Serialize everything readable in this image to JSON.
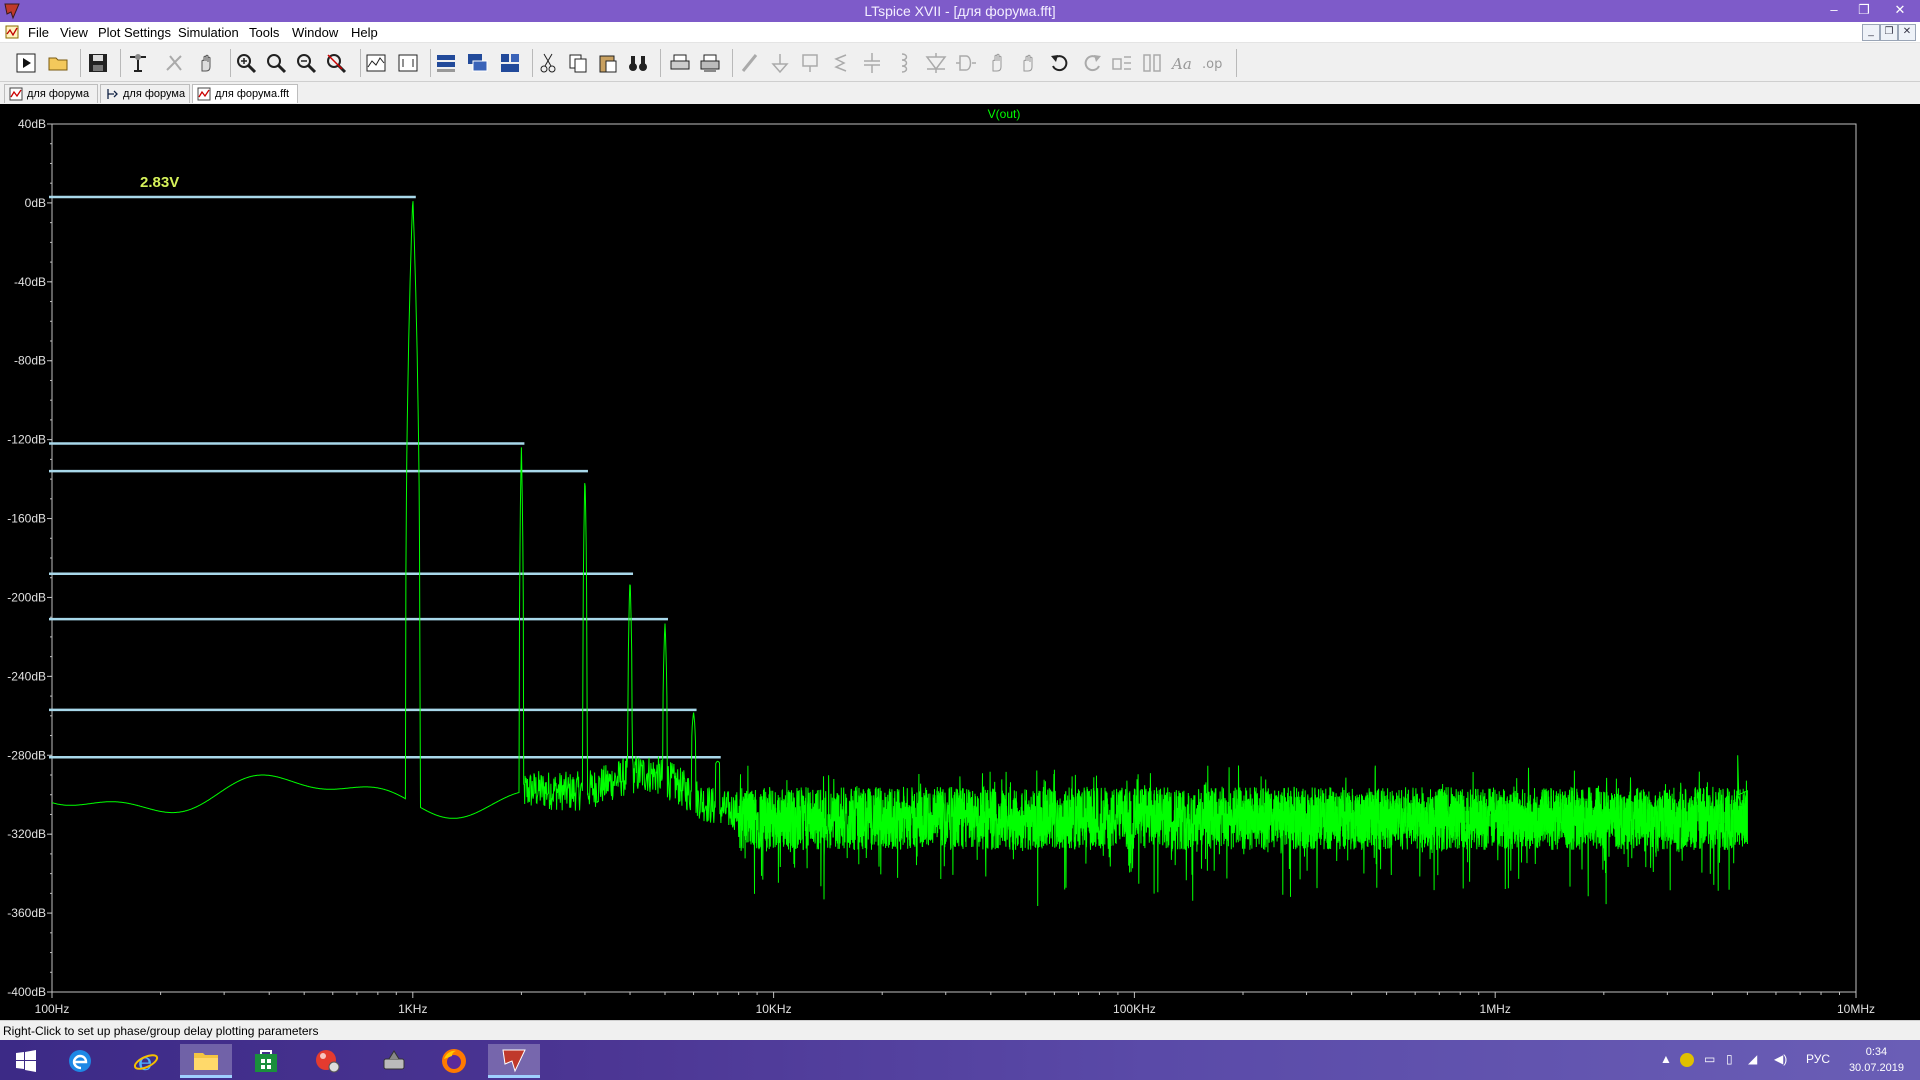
{
  "window": {
    "title": "LTspice XVII - [для форума.fft]",
    "minimize": "–",
    "restore": "❐",
    "close": "✕"
  },
  "menu": {
    "items": [
      "File",
      "View",
      "Plot Settings",
      "Simulation",
      "Tools",
      "Window",
      "Help"
    ]
  },
  "tabs": [
    {
      "label": "для форума",
      "icon": "waveform-icon"
    },
    {
      "label": "для форума",
      "icon": "schematic-icon"
    },
    {
      "label": "для форума.fft",
      "icon": "waveform-icon"
    }
  ],
  "plot": {
    "trace_label": "V(out)",
    "annotation": "2.83V",
    "background": "#000000",
    "trace_color": "#00ff00",
    "cursor_line_color": "#a8d8ea",
    "axis_color": "#c0c0c0"
  },
  "status": {
    "text": "Right-Click to set up phase/group delay plotting parameters"
  },
  "taskbar": {
    "lang": "РУС",
    "time": "0:34",
    "date": "30.07.2019"
  },
  "chart_data": {
    "type": "line",
    "title": "V(out)",
    "xlabel": "",
    "ylabel": "",
    "xscale": "log",
    "xlim": [
      100,
      10000000
    ],
    "ylim": [
      -400,
      40
    ],
    "x_ticks": [
      "100Hz",
      "1KHz",
      "10KHz",
      "100KHz",
      "1MHz",
      "10MHz"
    ],
    "y_ticks": [
      "40dB",
      "0dB",
      "-40dB",
      "-80dB",
      "-120dB",
      "-160dB",
      "-200dB",
      "-240dB",
      "-280dB",
      "-320dB",
      "-360dB",
      "-400dB"
    ],
    "grid": false,
    "series": [
      {
        "name": "V(out)",
        "harmonic_peaks": [
          {
            "f": 1000,
            "db": 3
          },
          {
            "f": 2000,
            "db": -123
          },
          {
            "f": 3000,
            "db": -137
          },
          {
            "f": 4000,
            "db": -190
          },
          {
            "f": 5000,
            "db": -213
          },
          {
            "f": 6000,
            "db": -258
          },
          {
            "f": 7000,
            "db": -283
          }
        ],
        "noise_floor_db": [
          -300,
          -320
        ],
        "spur": {
          "f": 4700000,
          "db": -280
        }
      }
    ],
    "marker_levels_db": [
      2,
      -123,
      -137,
      -189,
      -212,
      -258,
      -282
    ],
    "annotations": [
      "2.83V"
    ]
  }
}
